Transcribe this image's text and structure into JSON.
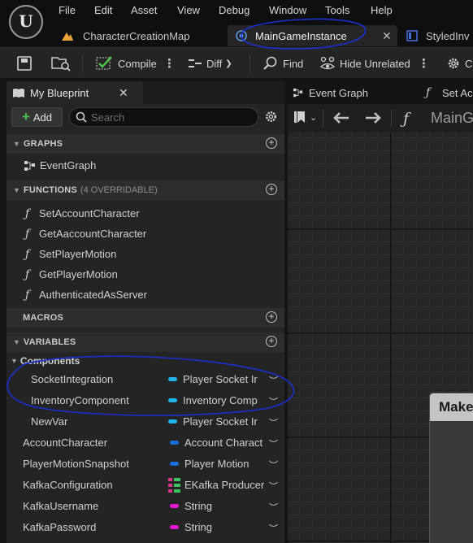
{
  "app": {
    "logo": "U"
  },
  "menu": [
    "File",
    "Edit",
    "Asset",
    "View",
    "Debug",
    "Window",
    "Tools",
    "Help"
  ],
  "tabs": [
    {
      "label": "CharacterCreationMap"
    },
    {
      "label": "MainGameInstance"
    },
    {
      "label": "StyledInv"
    }
  ],
  "toolbar": {
    "compile": "Compile",
    "diff": "Diff",
    "find": "Find",
    "hide_unrelated": "Hide Unrelated",
    "cut": "C"
  },
  "panel": {
    "tab_label": "My Blueprint",
    "add_label": "Add",
    "search_placeholder": "Search",
    "graphs": {
      "title": "GRAPHS",
      "items": [
        "EventGraph"
      ]
    },
    "functions": {
      "title": "FUNCTIONS",
      "subtitle": "(4 OVERRIDABLE)",
      "items": [
        "SetAccountCharacter",
        "GetAaccountCharacter",
        "SetPlayerMotion",
        "GetPlayerMotion",
        "AuthenticatedAsServer"
      ]
    },
    "macros": {
      "title": "MACROS"
    },
    "variables": {
      "title": "VARIABLES",
      "category": "Components",
      "items": [
        {
          "name": "SocketIntegration",
          "type": "Player Socket Ir",
          "color": "#1fb4ea"
        },
        {
          "name": "InventoryComponent",
          "type": "Inventory Comp",
          "color": "#1fb4ea"
        },
        {
          "name": "NewVar",
          "type": "Player Socket Ir",
          "color": "#1fb4ea"
        },
        {
          "name": "AccountCharacter",
          "type": "Account Charact",
          "color": "#1a6fd6"
        },
        {
          "name": "PlayerMotionSnapshot",
          "type": "Player Motion",
          "color": "#1a6fd6"
        },
        {
          "name": "KafkaConfiguration",
          "type": "EKafka Producer",
          "color": "#e0338a"
        },
        {
          "name": "KafkaUsername",
          "type": "String",
          "color": "#e51ad0"
        },
        {
          "name": "KafkaPassword",
          "type": "String",
          "color": "#e51ad0"
        }
      ]
    }
  },
  "graph": {
    "tabs": [
      {
        "label": "Event Graph"
      },
      {
        "label": "Set Acc"
      }
    ],
    "breadcrumb": "MainG",
    "node_title": "Make"
  },
  "annotation_color": "#1b2fd0"
}
